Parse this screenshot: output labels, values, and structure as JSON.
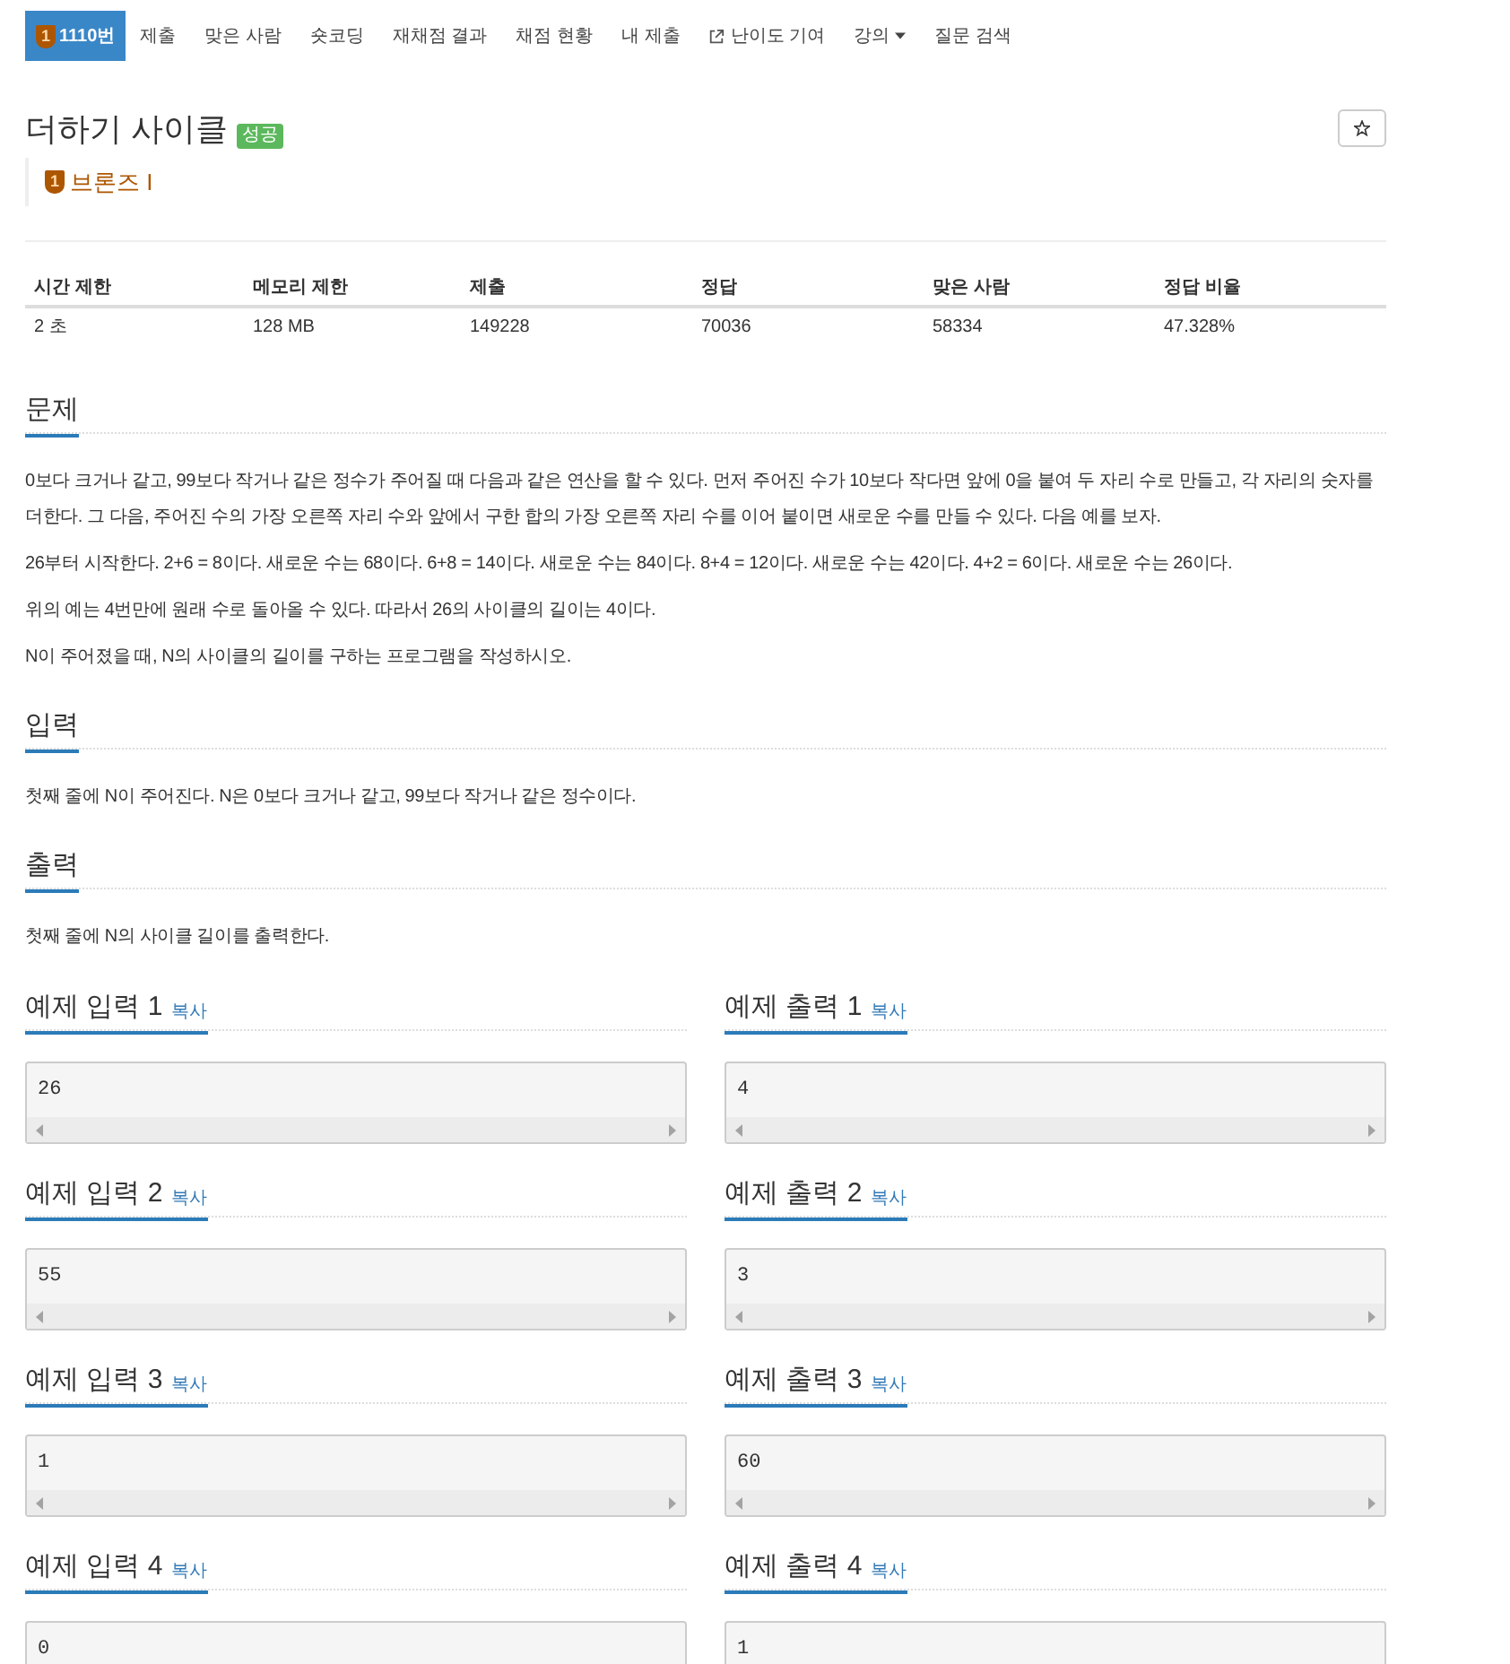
{
  "nav": {
    "tabs": [
      {
        "label": "1110번",
        "kind": "problem",
        "badge": "1",
        "selected": true
      },
      {
        "label": "제출",
        "kind": "plain",
        "selected": false
      },
      {
        "label": "맞은 사람",
        "kind": "plain",
        "selected": false
      },
      {
        "label": "숏코딩",
        "kind": "plain",
        "selected": false
      },
      {
        "label": "재채점 결과",
        "kind": "plain",
        "selected": false
      },
      {
        "label": "채점 현황",
        "kind": "plain",
        "selected": false
      },
      {
        "label": "내 제출",
        "kind": "plain",
        "selected": false
      },
      {
        "label": "난이도 기여",
        "kind": "external",
        "selected": false
      },
      {
        "label": "강의",
        "kind": "dropdown",
        "selected": false
      },
      {
        "label": "질문 검색",
        "kind": "plain",
        "selected": false
      }
    ]
  },
  "problem": {
    "title": "더하기 사이클",
    "status_badge": {
      "label": "성공",
      "kind": "success"
    },
    "tier": {
      "badge": "1",
      "label": "브론즈 I"
    }
  },
  "info_table": {
    "columns": [
      "시간 제한",
      "메모리 제한",
      "제출",
      "정답",
      "맞은 사람",
      "정답 비율"
    ],
    "rows": [
      [
        "2 초",
        "128 MB",
        "149228",
        "70036",
        "58334",
        "47.328%"
      ]
    ]
  },
  "sections": [
    {
      "title": "문제",
      "paragraphs": [
        "0보다 크거나 같고, 99보다 작거나 같은 정수가 주어질 때 다음과 같은 연산을 할 수 있다. 먼저 주어진 수가 10보다 작다면 앞에 0을 붙여 두 자리 수로 만들고, 각 자리의 숫자를 더한다. 그 다음, 주어진 수의 가장 오른쪽 자리 수와 앞에서 구한 합의 가장 오른쪽 자리 수를 이어 붙이면 새로운 수를 만들 수 있다. 다음 예를 보자.",
        "26부터 시작한다. 2+6 = 8이다. 새로운 수는 68이다. 6+8 = 14이다. 새로운 수는 84이다. 8+4 = 12이다. 새로운 수는 42이다. 4+2 = 6이다. 새로운 수는 26이다.",
        "위의 예는 4번만에 원래 수로 돌아올 수 있다. 따라서 26의 사이클의 길이는 4이다.",
        "N이 주어졌을 때, N의 사이클의 길이를 구하는 프로그램을 작성하시오."
      ]
    },
    {
      "title": "입력",
      "paragraphs": [
        "첫째 줄에 N이 주어진다. N은 0보다 크거나 같고, 99보다 작거나 같은 정수이다."
      ]
    },
    {
      "title": "출력",
      "paragraphs": [
        "첫째 줄에 N의 사이클 길이를 출력한다."
      ]
    }
  ],
  "samples": [
    {
      "input": {
        "title": "예제 입력 1",
        "copy": "복사",
        "data": "26"
      },
      "output": {
        "title": "예제 출력 1",
        "copy": "복사",
        "data": "4"
      }
    },
    {
      "input": {
        "title": "예제 입력 2",
        "copy": "복사",
        "data": "55"
      },
      "output": {
        "title": "예제 출력 2",
        "copy": "복사",
        "data": "3"
      }
    },
    {
      "input": {
        "title": "예제 입력 3",
        "copy": "복사",
        "data": "1"
      },
      "output": {
        "title": "예제 출력 3",
        "copy": "복사",
        "data": "60"
      }
    },
    {
      "input": {
        "title": "예제 입력 4",
        "copy": "복사",
        "data": "0"
      },
      "output": {
        "title": "예제 출력 4",
        "copy": "복사",
        "data": "1"
      }
    }
  ]
}
